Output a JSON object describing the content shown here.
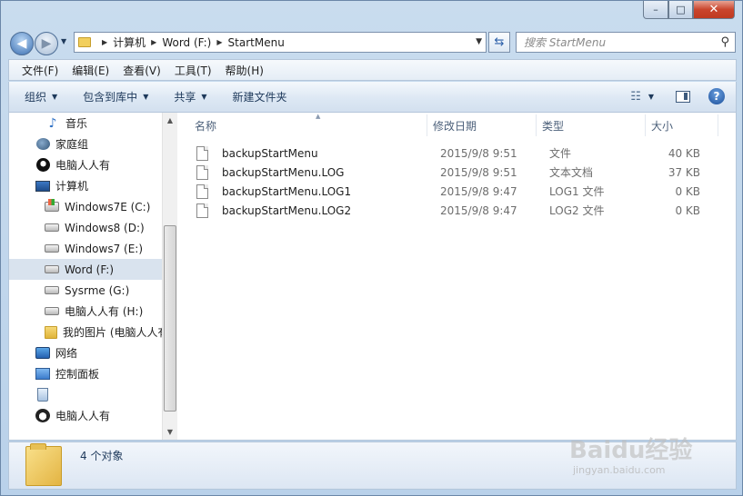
{
  "caption": {
    "minimize": "–",
    "maximize": "□",
    "close": "✕"
  },
  "address": {
    "parts": [
      "计算机",
      "Word (F:)",
      "StartMenu"
    ],
    "search_placeholder": "搜索 StartMenu"
  },
  "menu": [
    "文件(F)",
    "编辑(E)",
    "查看(V)",
    "工具(T)",
    "帮助(H)"
  ],
  "toolbar": {
    "organize": "组织",
    "include_library": "包含到库中",
    "share": "共享",
    "new_folder": "新建文件夹",
    "help": "?"
  },
  "nav": [
    {
      "label": "音乐",
      "icon": "music-icon"
    },
    {
      "label": "家庭组",
      "icon": "homegroup-icon"
    },
    {
      "label": "电脑人人有",
      "icon": "user-icon"
    },
    {
      "label": "计算机",
      "icon": "computer-icon"
    },
    {
      "label": "Windows7E (C:)",
      "icon": "system-drive-icon"
    },
    {
      "label": "Windows8 (D:)",
      "icon": "drive-icon"
    },
    {
      "label": "Windows7 (E:)",
      "icon": "drive-icon"
    },
    {
      "label": "Word (F:)",
      "icon": "drive-icon",
      "selected": true
    },
    {
      "label": "Sysrme (G:)",
      "icon": "drive-icon"
    },
    {
      "label": "电脑人人有 (H:)",
      "icon": "drive-icon"
    },
    {
      "label": "我的图片 (电脑人人有",
      "icon": "folder-icon"
    },
    {
      "label": "网络",
      "icon": "network-icon"
    },
    {
      "label": "控制面板",
      "icon": "control-panel-icon"
    },
    {
      "label": "",
      "icon": "recycle-bin-icon"
    },
    {
      "label": "电脑人人有",
      "icon": "panda-icon"
    }
  ],
  "columns": {
    "name": "名称",
    "date": "修改日期",
    "type": "类型",
    "size": "大小"
  },
  "files": [
    {
      "name": "backupStartMenu",
      "date": "2015/9/8 9:51",
      "type": "文件",
      "size": "40 KB"
    },
    {
      "name": "backupStartMenu.LOG",
      "date": "2015/9/8 9:51",
      "type": "文本文档",
      "size": "37 KB"
    },
    {
      "name": "backupStartMenu.LOG1",
      "date": "2015/9/8 9:47",
      "type": "LOG1 文件",
      "size": "0 KB"
    },
    {
      "name": "backupStartMenu.LOG2",
      "date": "2015/9/8 9:47",
      "type": "LOG2 文件",
      "size": "0 KB"
    }
  ],
  "status": {
    "count": "4 个对象"
  },
  "watermark": {
    "logo": "Baidu经验",
    "url": "jingyan.baidu.com"
  }
}
